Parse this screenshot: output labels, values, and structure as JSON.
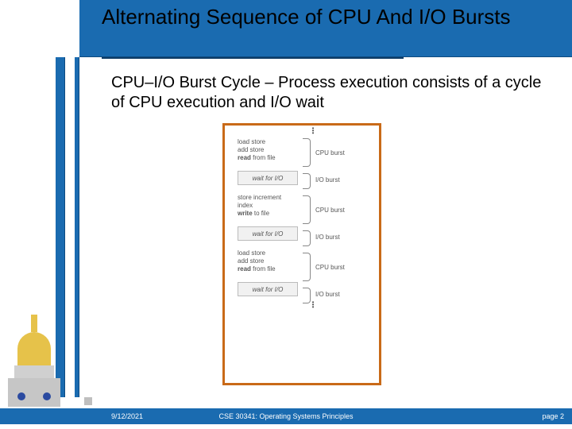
{
  "title": "Alternating Sequence of CPU And I/O Bursts",
  "body_text": "CPU–I/O Burst Cycle – Process execution consists of a cycle of CPU execution and I/O wait",
  "diagram": {
    "blocks": [
      {
        "type": "ops",
        "lines": [
          "load store",
          "add store",
          "read from file"
        ],
        "bold_last": "read",
        "brace": "CPU burst"
      },
      {
        "type": "wait",
        "text": "wait for I/O",
        "brace": "I/O burst"
      },
      {
        "type": "ops",
        "lines": [
          "store increment",
          "index",
          "write to file"
        ],
        "bold_last": "write",
        "brace": "CPU burst"
      },
      {
        "type": "wait",
        "text": "wait for I/O",
        "brace": "I/O burst"
      },
      {
        "type": "ops",
        "lines": [
          "load store",
          "add store",
          "read from file"
        ],
        "bold_last": "read",
        "brace": "CPU burst"
      },
      {
        "type": "wait",
        "text": "wait for I/O",
        "brace": "I/O burst"
      }
    ]
  },
  "footer": {
    "date": "9/12/2021",
    "course": "CSE 30341: Operating Systems Principles",
    "page": "page 2"
  }
}
